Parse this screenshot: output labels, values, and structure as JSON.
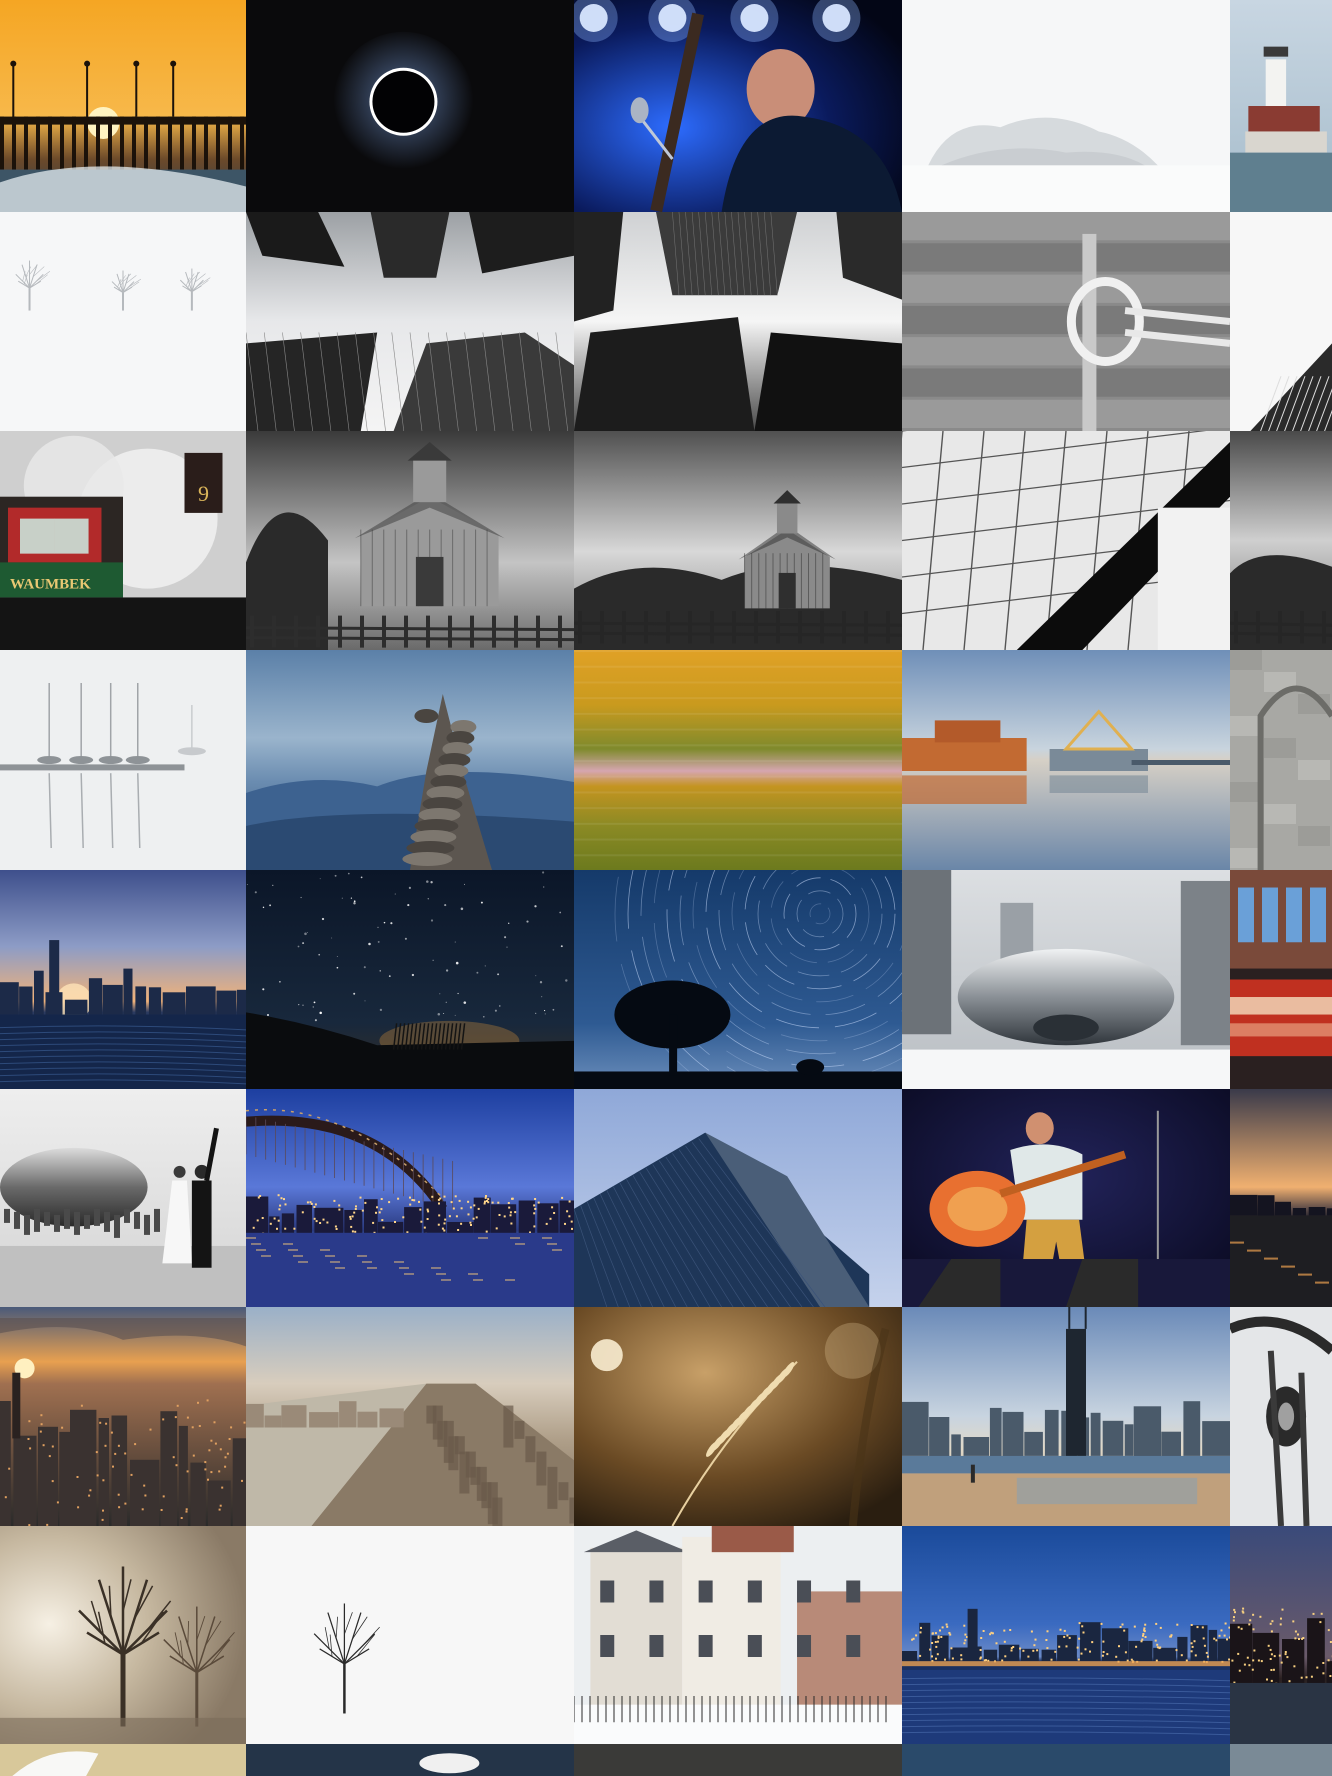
{
  "gallery": {
    "tiles": [
      {
        "name": "pier-sunset",
        "row": 0,
        "col": 0,
        "scene": "pier-sunset"
      },
      {
        "name": "solar-eclipse",
        "row": 0,
        "col": 1,
        "scene": "eclipse"
      },
      {
        "name": "concert-guitarist-blue",
        "row": 0,
        "col": 2,
        "scene": "concert-blue"
      },
      {
        "name": "snowy-trees-white",
        "row": 0,
        "col": 3,
        "scene": "snow-bushes"
      },
      {
        "name": "lighthouse",
        "row": 0,
        "col": 4,
        "scene": "lighthouse"
      },
      {
        "name": "fog-trees",
        "row": 1,
        "col": 0,
        "scene": "fog-trees"
      },
      {
        "name": "skyscrapers-up-bw",
        "row": 1,
        "col": 1,
        "scene": "skyscrapers-bw"
      },
      {
        "name": "skyscrapers-curve-bw",
        "row": 1,
        "col": 2,
        "scene": "skyscrapers-bw-2"
      },
      {
        "name": "rope-knot-wood",
        "row": 1,
        "col": 3,
        "scene": "rope-knot"
      },
      {
        "name": "building-corner-white",
        "row": 1,
        "col": 4,
        "scene": "white-building"
      },
      {
        "name": "steam-locomotive",
        "row": 2,
        "col": 0,
        "scene": "locomotive",
        "text": "WAUMBEK",
        "number": "9"
      },
      {
        "name": "barn-bw",
        "row": 2,
        "col": 1,
        "scene": "barn-bw"
      },
      {
        "name": "barn-bw-wide",
        "row": 2,
        "col": 2,
        "scene": "barn-bw-2"
      },
      {
        "name": "glass-facade-bw",
        "row": 2,
        "col": 3,
        "scene": "glass-facade"
      },
      {
        "name": "barn-bw-crop",
        "row": 2,
        "col": 4,
        "scene": "barn-bw-3"
      },
      {
        "name": "foggy-sailboats",
        "row": 3,
        "col": 0,
        "scene": "fog-boats"
      },
      {
        "name": "rock-cairn-mountains",
        "row": 3,
        "col": 1,
        "scene": "cairn"
      },
      {
        "name": "motion-blur-field",
        "row": 3,
        "col": 2,
        "scene": "blur-field"
      },
      {
        "name": "harbor-reflection",
        "row": 3,
        "col": 3,
        "scene": "harbor"
      },
      {
        "name": "stone-arch-detail",
        "row": 3,
        "col": 4,
        "scene": "stone-arch"
      },
      {
        "name": "city-skyline-dusk-water",
        "row": 4,
        "col": 0,
        "scene": "skyline-dusk"
      },
      {
        "name": "night-stars-field",
        "row": 4,
        "col": 1,
        "scene": "night-stars"
      },
      {
        "name": "star-trails-tree",
        "row": 4,
        "col": 2,
        "scene": "star-trails"
      },
      {
        "name": "cloud-gate-snow",
        "row": 4,
        "col": 3,
        "scene": "bean-snow"
      },
      {
        "name": "red-bus-motion",
        "row": 4,
        "col": 4,
        "scene": "red-bus"
      },
      {
        "name": "cloud-gate-wedding",
        "row": 5,
        "col": 0,
        "scene": "bean-wedding"
      },
      {
        "name": "bridge-night-city",
        "row": 5,
        "col": 1,
        "scene": "bridge"
      },
      {
        "name": "glass-tower-up",
        "row": 5,
        "col": 2,
        "scene": "glass-tower"
      },
      {
        "name": "upright-bass-performer",
        "row": 5,
        "col": 3,
        "scene": "bass-player"
      },
      {
        "name": "skyline-sunset-water",
        "row": 5,
        "col": 4,
        "scene": "skyline-sunset-crop"
      },
      {
        "name": "city-aerial-sunset",
        "row": 6,
        "col": 0,
        "scene": "aerial-sunset"
      },
      {
        "name": "lakefront-aerial-haze",
        "row": 6,
        "col": 1,
        "scene": "aerial-haze"
      },
      {
        "name": "wheat-closeup-bokeh",
        "row": 6,
        "col": 2,
        "scene": "wheat"
      },
      {
        "name": "skyline-beach-walk",
        "row": 6,
        "col": 3,
        "scene": "skyline-beach"
      },
      {
        "name": "ship-rigging-bw",
        "row": 6,
        "col": 4,
        "scene": "rigging"
      },
      {
        "name": "foggy-oak-trees",
        "row": 7,
        "col": 0,
        "scene": "fog-oaks"
      },
      {
        "name": "lone-tree-snow",
        "row": 7,
        "col": 1,
        "scene": "lone-tree"
      },
      {
        "name": "townhouses-snow",
        "row": 7,
        "col": 2,
        "scene": "townhouses"
      },
      {
        "name": "skyline-blue-hour-lake",
        "row": 7,
        "col": 3,
        "scene": "skyline-blue"
      },
      {
        "name": "skyline-night-crop",
        "row": 7,
        "col": 4,
        "scene": "skyline-night"
      },
      {
        "name": "bird-wing-partial",
        "row": 8,
        "col": 0,
        "scene": "partial-bird"
      },
      {
        "name": "water-swan-partial",
        "row": 8,
        "col": 1,
        "scene": "partial-water"
      },
      {
        "name": "dark-partial",
        "row": 8,
        "col": 2,
        "scene": "partial-dark"
      },
      {
        "name": "blue-partial",
        "row": 8,
        "col": 3,
        "scene": "partial-blue"
      },
      {
        "name": "lake-partial",
        "row": 8,
        "col": 4,
        "scene": "partial-lake"
      }
    ]
  },
  "colors": {
    "background": "#ffffff"
  }
}
